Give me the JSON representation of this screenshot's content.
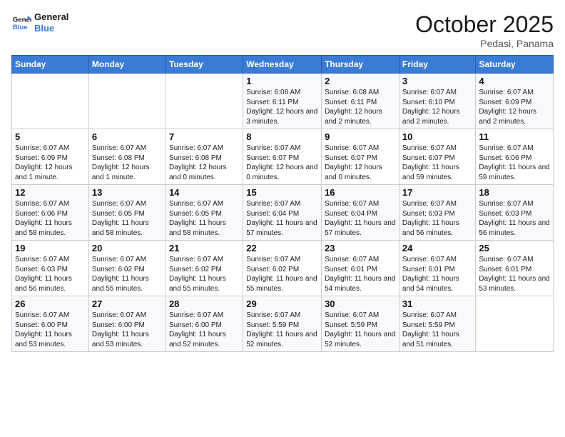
{
  "header": {
    "logo_general": "General",
    "logo_blue": "Blue",
    "month": "October 2025",
    "location": "Pedasi, Panama"
  },
  "weekdays": [
    "Sunday",
    "Monday",
    "Tuesday",
    "Wednesday",
    "Thursday",
    "Friday",
    "Saturday"
  ],
  "weeks": [
    [
      {
        "day": "",
        "info": ""
      },
      {
        "day": "",
        "info": ""
      },
      {
        "day": "",
        "info": ""
      },
      {
        "day": "1",
        "info": "Sunrise: 6:08 AM\nSunset: 6:11 PM\nDaylight: 12 hours and 3 minutes."
      },
      {
        "day": "2",
        "info": "Sunrise: 6:08 AM\nSunset: 6:11 PM\nDaylight: 12 hours and 2 minutes."
      },
      {
        "day": "3",
        "info": "Sunrise: 6:07 AM\nSunset: 6:10 PM\nDaylight: 12 hours and 2 minutes."
      },
      {
        "day": "4",
        "info": "Sunrise: 6:07 AM\nSunset: 6:09 PM\nDaylight: 12 hours and 2 minutes."
      }
    ],
    [
      {
        "day": "5",
        "info": "Sunrise: 6:07 AM\nSunset: 6:09 PM\nDaylight: 12 hours and 1 minute."
      },
      {
        "day": "6",
        "info": "Sunrise: 6:07 AM\nSunset: 6:08 PM\nDaylight: 12 hours and 1 minute."
      },
      {
        "day": "7",
        "info": "Sunrise: 6:07 AM\nSunset: 6:08 PM\nDaylight: 12 hours and 0 minutes."
      },
      {
        "day": "8",
        "info": "Sunrise: 6:07 AM\nSunset: 6:07 PM\nDaylight: 12 hours and 0 minutes."
      },
      {
        "day": "9",
        "info": "Sunrise: 6:07 AM\nSunset: 6:07 PM\nDaylight: 12 hours and 0 minutes."
      },
      {
        "day": "10",
        "info": "Sunrise: 6:07 AM\nSunset: 6:07 PM\nDaylight: 11 hours and 59 minutes."
      },
      {
        "day": "11",
        "info": "Sunrise: 6:07 AM\nSunset: 6:06 PM\nDaylight: 11 hours and 59 minutes."
      }
    ],
    [
      {
        "day": "12",
        "info": "Sunrise: 6:07 AM\nSunset: 6:06 PM\nDaylight: 11 hours and 58 minutes."
      },
      {
        "day": "13",
        "info": "Sunrise: 6:07 AM\nSunset: 6:05 PM\nDaylight: 11 hours and 58 minutes."
      },
      {
        "day": "14",
        "info": "Sunrise: 6:07 AM\nSunset: 6:05 PM\nDaylight: 11 hours and 58 minutes."
      },
      {
        "day": "15",
        "info": "Sunrise: 6:07 AM\nSunset: 6:04 PM\nDaylight: 11 hours and 57 minutes."
      },
      {
        "day": "16",
        "info": "Sunrise: 6:07 AM\nSunset: 6:04 PM\nDaylight: 11 hours and 57 minutes."
      },
      {
        "day": "17",
        "info": "Sunrise: 6:07 AM\nSunset: 6:03 PM\nDaylight: 11 hours and 56 minutes."
      },
      {
        "day": "18",
        "info": "Sunrise: 6:07 AM\nSunset: 6:03 PM\nDaylight: 11 hours and 56 minutes."
      }
    ],
    [
      {
        "day": "19",
        "info": "Sunrise: 6:07 AM\nSunset: 6:03 PM\nDaylight: 11 hours and 56 minutes."
      },
      {
        "day": "20",
        "info": "Sunrise: 6:07 AM\nSunset: 6:02 PM\nDaylight: 11 hours and 55 minutes."
      },
      {
        "day": "21",
        "info": "Sunrise: 6:07 AM\nSunset: 6:02 PM\nDaylight: 11 hours and 55 minutes."
      },
      {
        "day": "22",
        "info": "Sunrise: 6:07 AM\nSunset: 6:02 PM\nDaylight: 11 hours and 55 minutes."
      },
      {
        "day": "23",
        "info": "Sunrise: 6:07 AM\nSunset: 6:01 PM\nDaylight: 11 hours and 54 minutes."
      },
      {
        "day": "24",
        "info": "Sunrise: 6:07 AM\nSunset: 6:01 PM\nDaylight: 11 hours and 54 minutes."
      },
      {
        "day": "25",
        "info": "Sunrise: 6:07 AM\nSunset: 6:01 PM\nDaylight: 11 hours and 53 minutes."
      }
    ],
    [
      {
        "day": "26",
        "info": "Sunrise: 6:07 AM\nSunset: 6:00 PM\nDaylight: 11 hours and 53 minutes."
      },
      {
        "day": "27",
        "info": "Sunrise: 6:07 AM\nSunset: 6:00 PM\nDaylight: 11 hours and 53 minutes."
      },
      {
        "day": "28",
        "info": "Sunrise: 6:07 AM\nSunset: 6:00 PM\nDaylight: 11 hours and 52 minutes."
      },
      {
        "day": "29",
        "info": "Sunrise: 6:07 AM\nSunset: 5:59 PM\nDaylight: 11 hours and 52 minutes."
      },
      {
        "day": "30",
        "info": "Sunrise: 6:07 AM\nSunset: 5:59 PM\nDaylight: 11 hours and 52 minutes."
      },
      {
        "day": "31",
        "info": "Sunrise: 6:07 AM\nSunset: 5:59 PM\nDaylight: 11 hours and 51 minutes."
      },
      {
        "day": "",
        "info": ""
      }
    ]
  ]
}
